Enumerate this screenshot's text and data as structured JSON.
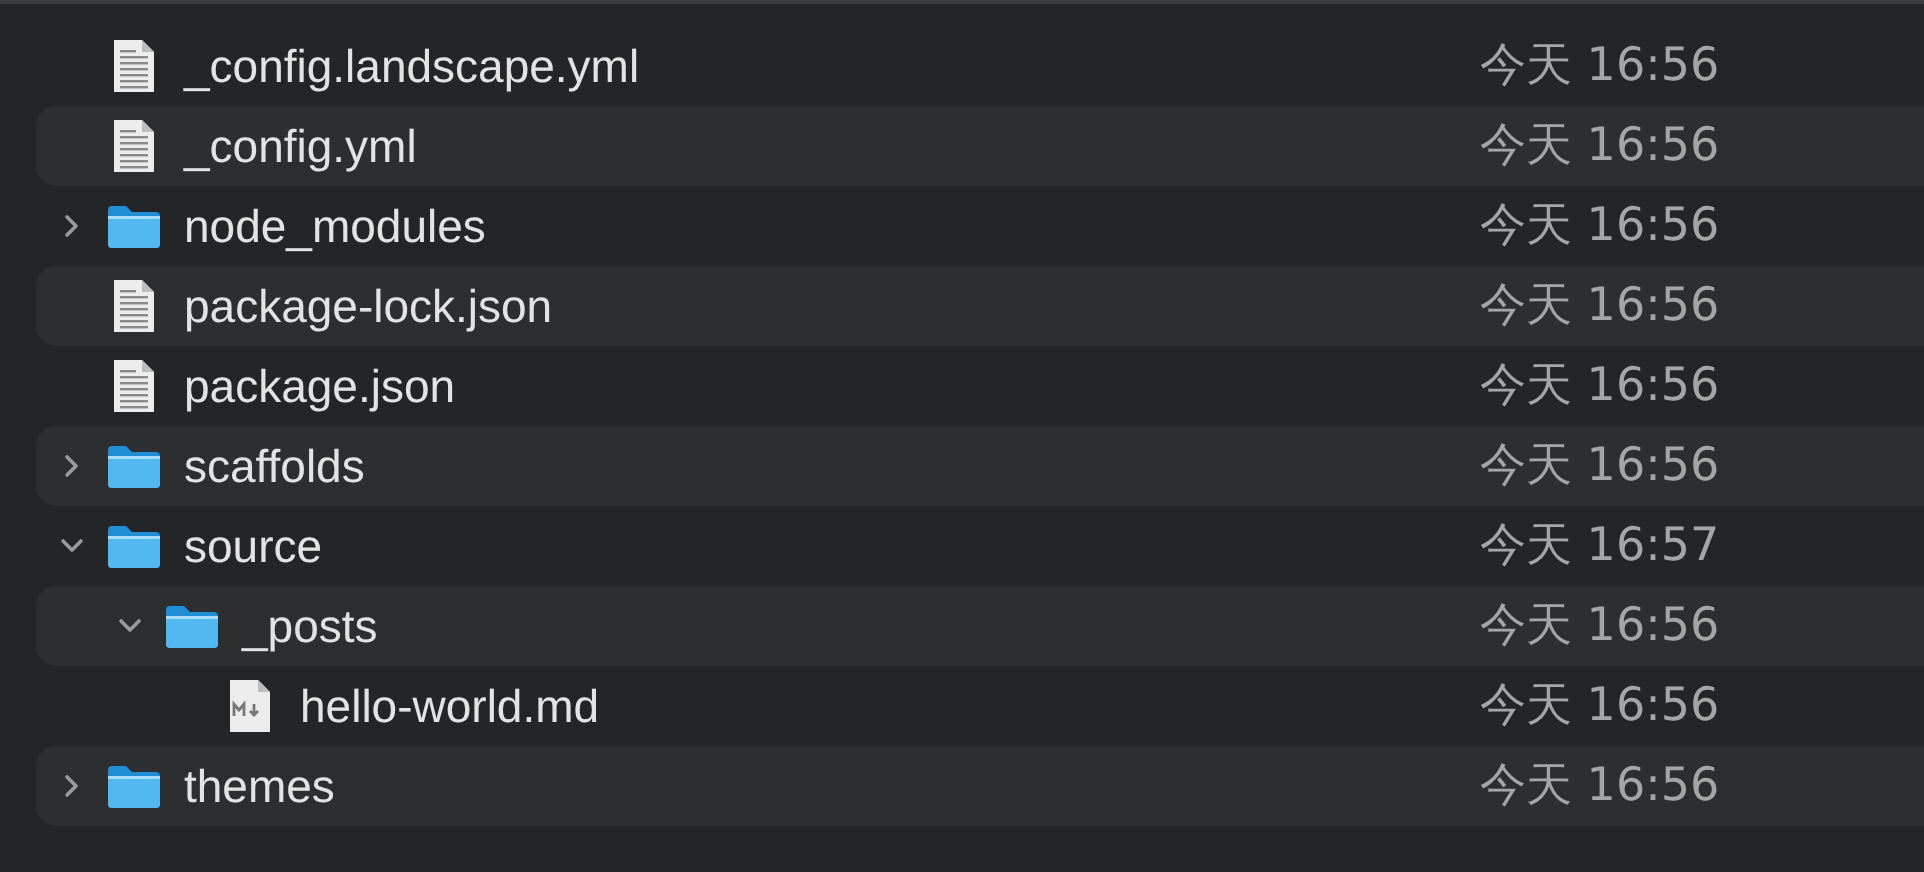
{
  "files": [
    {
      "name": "_config.landscape.yml",
      "kind": "document",
      "modified": "今天 16:56"
    },
    {
      "name": "_config.yml",
      "kind": "document",
      "modified": "今天 16:56"
    },
    {
      "name": "node_modules",
      "kind": "folder",
      "expanded": false,
      "modified": "今天 16:56"
    },
    {
      "name": "package-lock.json",
      "kind": "document",
      "modified": "今天 16:56"
    },
    {
      "name": "package.json",
      "kind": "document",
      "modified": "今天 16:56"
    },
    {
      "name": "scaffolds",
      "kind": "folder",
      "expanded": false,
      "modified": "今天 16:56"
    },
    {
      "name": "source",
      "kind": "folder",
      "expanded": true,
      "modified": "今天 16:57",
      "children": [
        {
          "name": "_posts",
          "kind": "folder",
          "expanded": true,
          "modified": "今天 16:56",
          "children": [
            {
              "name": "hello-world.md",
              "kind": "markdown",
              "modified": "今天 16:56"
            }
          ]
        }
      ]
    },
    {
      "name": "themes",
      "kind": "folder",
      "expanded": false,
      "modified": "今天 16:56"
    }
  ]
}
